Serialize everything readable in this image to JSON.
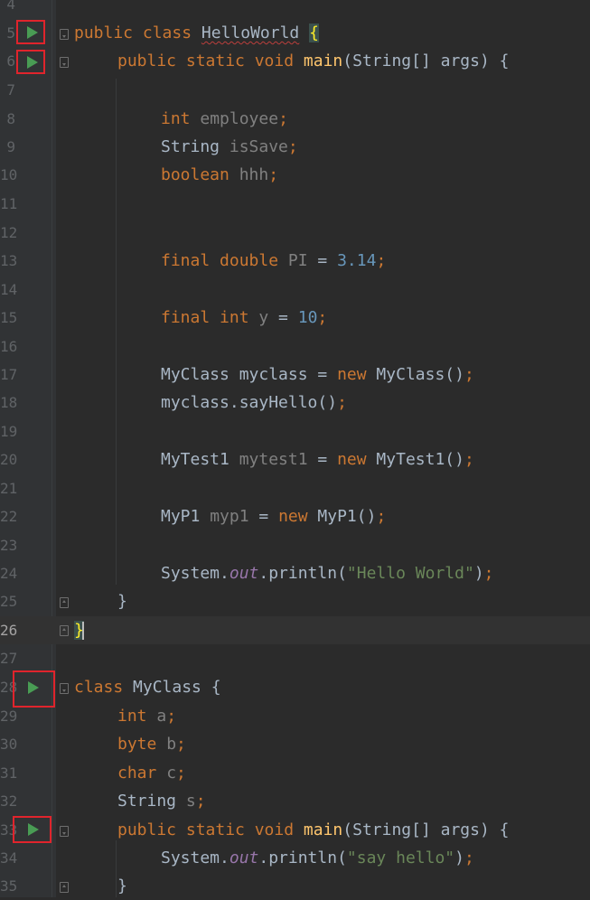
{
  "editor": {
    "file_class": "HelloWorld",
    "current_line": "26",
    "lines": [
      {
        "n": "4"
      },
      {
        "n": "5"
      },
      {
        "n": "6"
      },
      {
        "n": "7"
      },
      {
        "n": "8"
      },
      {
        "n": "9"
      },
      {
        "n": "10"
      },
      {
        "n": "11"
      },
      {
        "n": "12"
      },
      {
        "n": "13"
      },
      {
        "n": "14"
      },
      {
        "n": "15"
      },
      {
        "n": "16"
      },
      {
        "n": "17"
      },
      {
        "n": "18"
      },
      {
        "n": "19"
      },
      {
        "n": "20"
      },
      {
        "n": "21"
      },
      {
        "n": "22"
      },
      {
        "n": "23"
      },
      {
        "n": "24"
      },
      {
        "n": "25"
      },
      {
        "n": "26"
      },
      {
        "n": "27"
      },
      {
        "n": "28"
      },
      {
        "n": "29"
      },
      {
        "n": "30"
      },
      {
        "n": "31"
      },
      {
        "n": "32"
      },
      {
        "n": "33"
      },
      {
        "n": "34"
      },
      {
        "n": "35"
      }
    ],
    "code": {
      "l5": {
        "kw": "public class ",
        "name": "HelloWorld",
        "sp": " ",
        "brace": "{"
      },
      "l6": {
        "kw": "public static void ",
        "fn": "main",
        "rest": "(String[] args) {"
      },
      "l8": {
        "kw": "int ",
        "un": "employee",
        "semi": ";"
      },
      "l9": {
        "type": "String ",
        "un": "isSave",
        "semi": ";"
      },
      "l10": {
        "kw": "boolean ",
        "un": "hhh",
        "semi": ";"
      },
      "l13": {
        "kw": "final double ",
        "un": "PI",
        "eq": " = ",
        "num": "3.14",
        "semi": ";"
      },
      "l15": {
        "kw": "final int ",
        "un": "y",
        "eq": " = ",
        "num": "10",
        "semi": ";"
      },
      "l17": {
        "pre": "MyClass myclass = ",
        "kw": "new",
        "post": " MyClass()",
        "semi": ";"
      },
      "l18": {
        "pre": "myclass.sayHello()",
        "semi": ";"
      },
      "l20": {
        "pre": "MyTest1 ",
        "un": "mytest1",
        "eq": " = ",
        "kw": "new",
        "post": " MyTest1()",
        "semi": ";"
      },
      "l22": {
        "pre": "MyP1 ",
        "un": "myp1",
        "eq": " = ",
        "kw": "new",
        "post": " MyP1()",
        "semi": ";"
      },
      "l24": {
        "pre": "System.",
        "stat": "out",
        "mid": ".println(",
        "str": "\"Hello World\"",
        "close": ")",
        "semi": ";"
      },
      "l25": {
        "text": "}"
      },
      "l26": {
        "text": "}"
      },
      "l28": {
        "kw": "class ",
        "rest": "MyClass {"
      },
      "l29": {
        "kw": "int ",
        "un": "a",
        "semi": ";"
      },
      "l30": {
        "kw": "byte ",
        "un": "b",
        "semi": ";"
      },
      "l31": {
        "kw": "char ",
        "un": "c",
        "semi": ";"
      },
      "l32": {
        "type": "String ",
        "un": "s",
        "semi": ";"
      },
      "l33": {
        "kw": "public static void ",
        "fn": "main",
        "rest": "(String[] args) {"
      },
      "l34": {
        "pre": "System.",
        "stat": "out",
        "mid": ".println(",
        "str": "\"say hello\"",
        "close": ")",
        "semi": ";"
      },
      "l35": {
        "text": "}"
      }
    },
    "icons": {
      "run": "run-gutter-icon",
      "fold": "fold-marker-icon"
    },
    "colors": {
      "background": "#2b2b2b",
      "keyword": "#cc7832",
      "function": "#ffc66d",
      "number": "#6897bb",
      "string": "#6a8759",
      "unused": "#808080",
      "static_field": "#9876aa",
      "run_icon": "#499c54",
      "highlight_box": "#e0242c"
    }
  }
}
